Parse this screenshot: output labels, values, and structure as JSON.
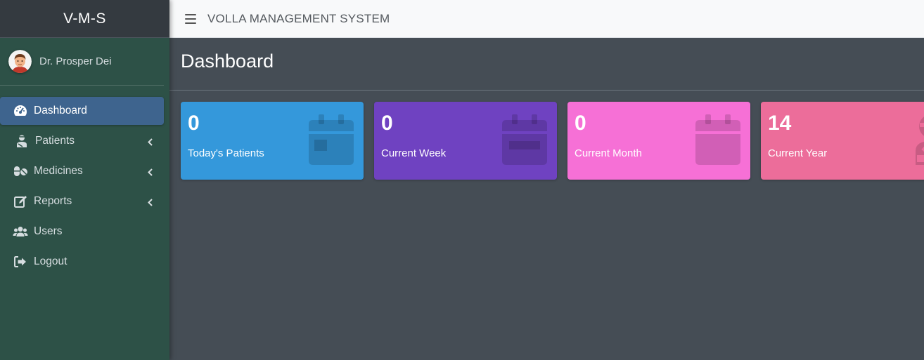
{
  "brand": "V-M-S",
  "user": {
    "name": "Dr. Prosper Dei"
  },
  "sidebar": {
    "items": [
      {
        "label": "Dashboard",
        "icon": "tachometer-icon",
        "active": true
      },
      {
        "label": "Patients",
        "icon": "user-injured-icon",
        "expandable": true
      },
      {
        "label": "Medicines",
        "icon": "pills-icon",
        "expandable": true
      },
      {
        "label": "Reports",
        "icon": "edit-icon",
        "expandable": true
      },
      {
        "label": "Users",
        "icon": "users-icon"
      },
      {
        "label": "Logout",
        "icon": "sign-out-icon"
      }
    ]
  },
  "topbar": {
    "title": "VOLLA MANAGEMENT SYSTEM",
    "menu_icon": "hamburger-icon"
  },
  "page": {
    "title": "Dashboard"
  },
  "stats": [
    {
      "value": "0",
      "label": "Today's Patients",
      "color": "#3498db",
      "icon": "calendar-day-icon"
    },
    {
      "value": "0",
      "label": "Current Week",
      "color": "#6f42c1",
      "icon": "calendar-week-icon"
    },
    {
      "value": "0",
      "label": "Current Month",
      "color": "#f670d6",
      "icon": "calendar-icon"
    },
    {
      "value": "14",
      "label": "Current Year",
      "color": "#ec6d9a",
      "icon": "user-injured-icon"
    }
  ]
}
